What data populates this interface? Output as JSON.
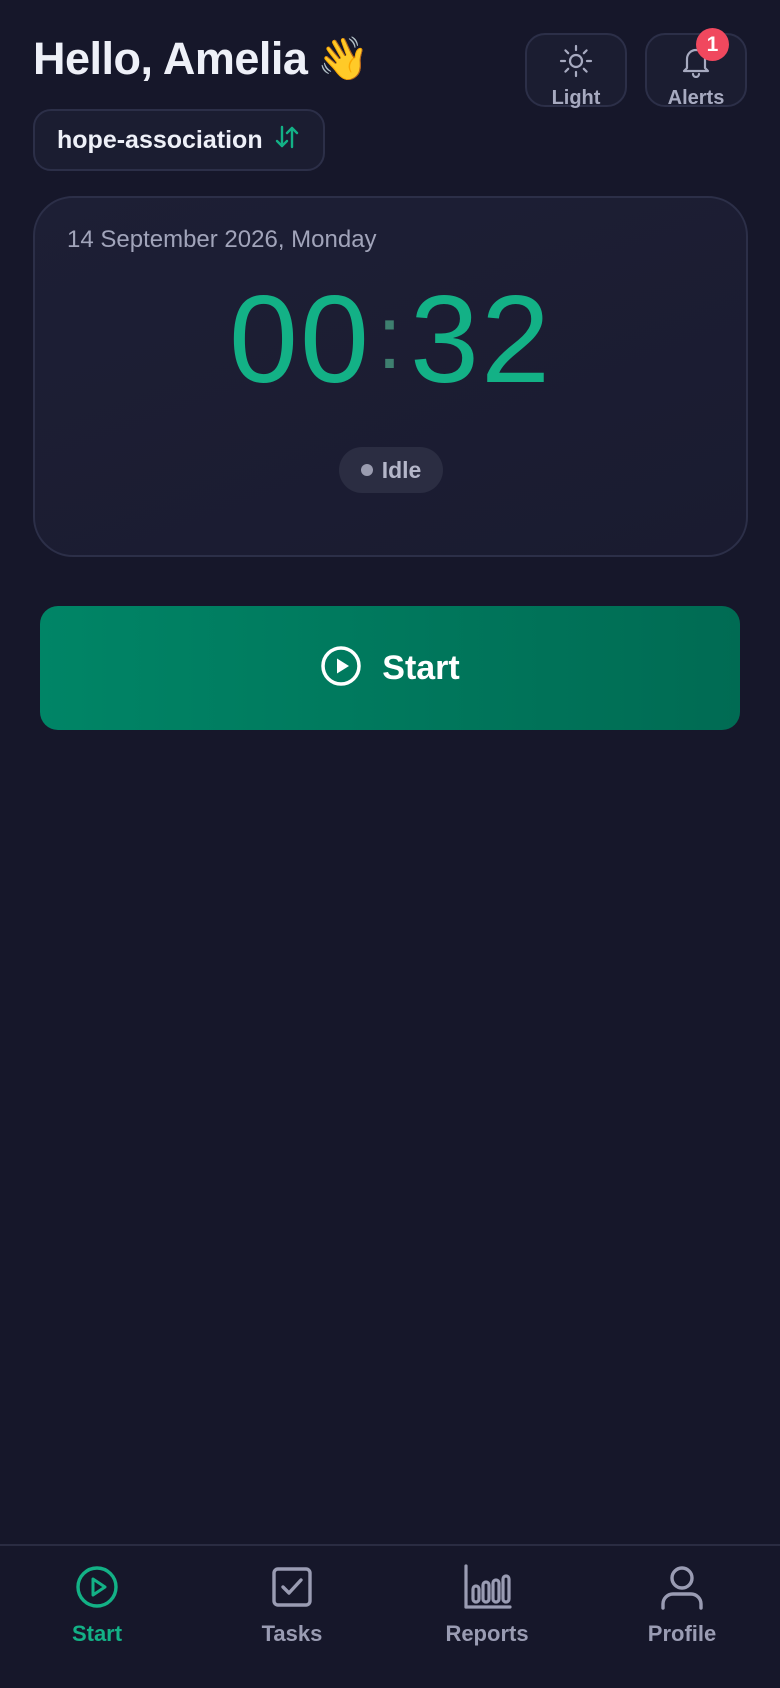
{
  "header": {
    "greeting": "Hello, Amelia",
    "wave_emoji": "👋",
    "theme_button_label": "Light",
    "theme_icon": "sun-icon",
    "alerts_button_label": "Alerts",
    "alerts_icon": "bell-icon",
    "alerts_count": "1"
  },
  "org": {
    "name": "hope-association",
    "switch_icon": "swap-vertical-icon"
  },
  "timer": {
    "date": "14 September 2026, Monday",
    "minutes": "00",
    "separator": ":",
    "seconds": "32",
    "status": "Idle"
  },
  "actions": {
    "start_label": "Start",
    "start_icon": "play-circle-icon"
  },
  "nav": {
    "items": [
      {
        "label": "Start",
        "icon": "play-circle-icon",
        "active": true
      },
      {
        "label": "Tasks",
        "icon": "checkbox-icon",
        "active": false
      },
      {
        "label": "Reports",
        "icon": "bar-chart-icon",
        "active": false
      },
      {
        "label": "Profile",
        "icon": "user-icon",
        "active": false
      }
    ]
  },
  "colors": {
    "background": "#16172a",
    "accent": "#13b186",
    "start_button": "#00785c",
    "badge": "#f0485e"
  }
}
